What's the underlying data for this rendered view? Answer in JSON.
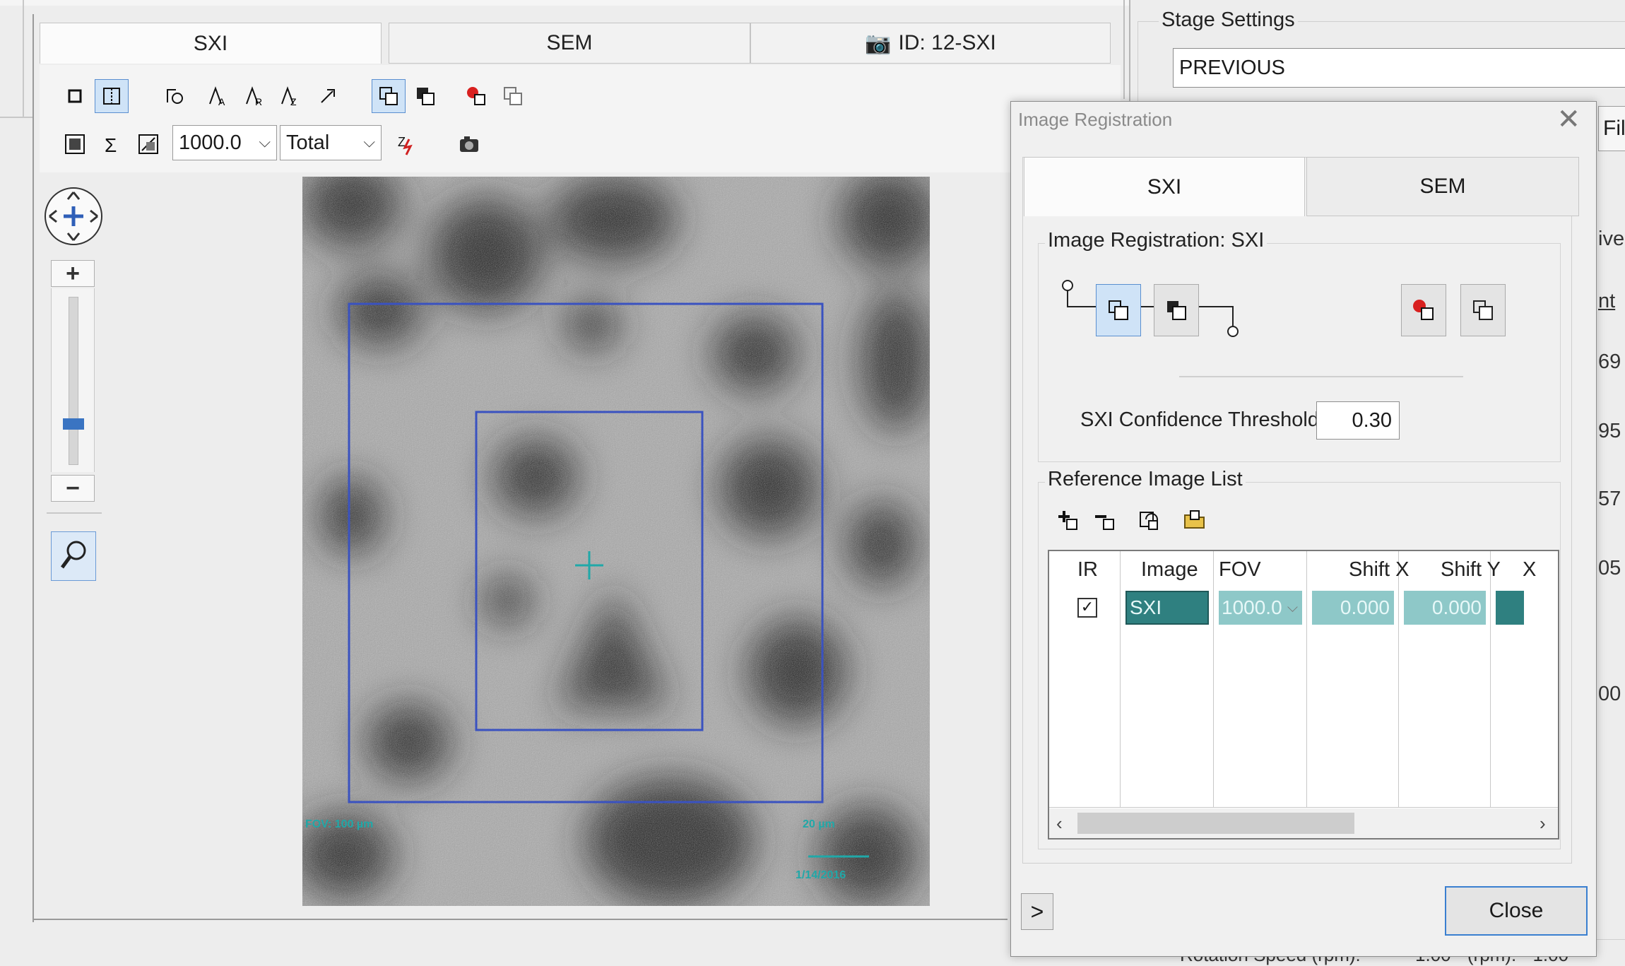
{
  "viewer": {
    "tabs": [
      {
        "label": "SXI"
      },
      {
        "label": "SEM"
      },
      {
        "label": "ID: 12-SXI"
      }
    ],
    "fov_value": "1000.0",
    "mode_value": "Total",
    "overlay": {
      "fov_text": "FOV: 100 µm",
      "scale_text": "20 µm",
      "date_text": "1/14/2016"
    },
    "zoom_level": 0.22
  },
  "stage_settings": {
    "label": "Stage Settings",
    "value": "PREVIOUS"
  },
  "right_panel": {
    "fil_label": "Fil",
    "edge_texts": [
      "ive",
      "nt",
      "69",
      "95",
      "57",
      "05",
      "00"
    ],
    "bottom_text": "Rotation Speed (rpm):",
    "bottom_val1": "1.00",
    "bottom_text2": "(rpm):",
    "bottom_val2": "1.00"
  },
  "dialog": {
    "title": "Image Registration",
    "tabs": [
      {
        "label": "SXI"
      },
      {
        "label": "SEM"
      }
    ],
    "group_title": "Image Registration: SXI",
    "threshold_label": "SXI Confidence Threshold",
    "threshold_value": "0.30",
    "ref_list_title": "Reference Image List",
    "columns": [
      "IR",
      "Image",
      "FOV",
      "Shift X",
      "Shift Y",
      "X"
    ],
    "row": {
      "ir_checked": true,
      "image": "SXI",
      "fov": "1000.0",
      "shift_x": "0.000",
      "shift_y": "0.000"
    },
    "close_label": "Close",
    "expand_label": ">"
  },
  "colors": {
    "accent": "#3a7fd0",
    "teal": "#2f8080",
    "teal_light": "#8ec8c8",
    "overlay_teal": "#20a8a8",
    "roi_blue": "#3a52c0"
  }
}
